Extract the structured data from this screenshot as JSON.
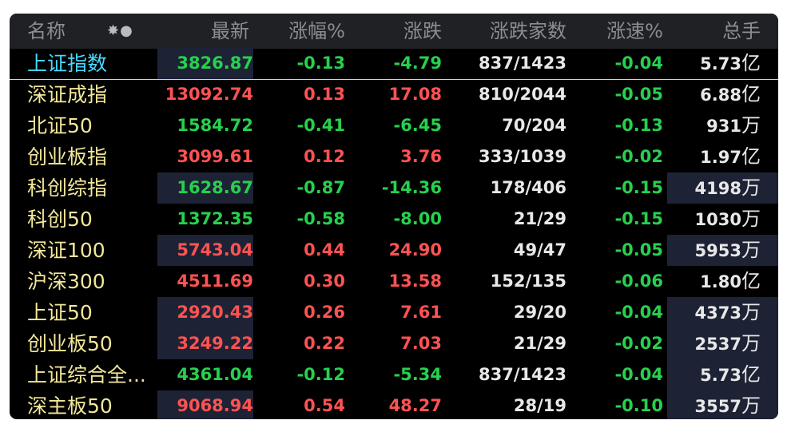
{
  "header": {
    "name": "名称",
    "sort_icon": "✸●",
    "last": "最新",
    "pct": "涨幅%",
    "chg": "涨跌",
    "count": "涨跌家数",
    "speed": "涨速%",
    "volume": "总手"
  },
  "colors": {
    "up": "#ff5252",
    "down": "#27d04e",
    "name": "#f2e79a",
    "selected_name": "#49d8ff",
    "highlight": "#1d2335"
  },
  "rows": [
    {
      "name": "上证指数",
      "last": "3826.87",
      "pct": "-0.13",
      "chg": "-4.79",
      "count": "837/1423",
      "speed": "-0.04",
      "vol_num": "5.73",
      "vol_unit": "亿"
    },
    {
      "name": "深证成指",
      "last": "13092.74",
      "pct": "0.13",
      "chg": "17.08",
      "count": "810/2044",
      "speed": "-0.05",
      "vol_num": "6.88",
      "vol_unit": "亿"
    },
    {
      "name": "北证50",
      "last": "1584.72",
      "pct": "-0.41",
      "chg": "-6.45",
      "count": "70/204",
      "speed": "-0.13",
      "vol_num": "931",
      "vol_unit": "万"
    },
    {
      "name": "创业板指",
      "last": "3099.61",
      "pct": "0.12",
      "chg": "3.76",
      "count": "333/1039",
      "speed": "-0.02",
      "vol_num": "1.97",
      "vol_unit": "亿"
    },
    {
      "name": "科创综指",
      "last": "1628.67",
      "pct": "-0.87",
      "chg": "-14.36",
      "count": "178/406",
      "speed": "-0.15",
      "vol_num": "4198",
      "vol_unit": "万"
    },
    {
      "name": "科创50",
      "last": "1372.35",
      "pct": "-0.58",
      "chg": "-8.00",
      "count": "21/29",
      "speed": "-0.15",
      "vol_num": "1030",
      "vol_unit": "万"
    },
    {
      "name": "深证100",
      "last": "5743.04",
      "pct": "0.44",
      "chg": "24.90",
      "count": "49/47",
      "speed": "-0.05",
      "vol_num": "5953",
      "vol_unit": "万"
    },
    {
      "name": "沪深300",
      "last": "4511.69",
      "pct": "0.30",
      "chg": "13.58",
      "count": "152/135",
      "speed": "-0.06",
      "vol_num": "1.80",
      "vol_unit": "亿"
    },
    {
      "name": "上证50",
      "last": "2920.43",
      "pct": "0.26",
      "chg": "7.61",
      "count": "29/20",
      "speed": "-0.04",
      "vol_num": "4373",
      "vol_unit": "万"
    },
    {
      "name": "创业板50",
      "last": "3249.22",
      "pct": "0.22",
      "chg": "7.03",
      "count": "21/29",
      "speed": "-0.02",
      "vol_num": "2537",
      "vol_unit": "万"
    },
    {
      "name": "上证综合全...",
      "last": "4361.04",
      "pct": "-0.12",
      "chg": "-5.34",
      "count": "837/1423",
      "speed": "-0.04",
      "vol_num": "5.73",
      "vol_unit": "亿"
    },
    {
      "name": "深主板50",
      "last": "9068.94",
      "pct": "0.54",
      "chg": "48.27",
      "count": "28/19",
      "speed": "-0.10",
      "vol_num": "3557",
      "vol_unit": "万"
    }
  ]
}
